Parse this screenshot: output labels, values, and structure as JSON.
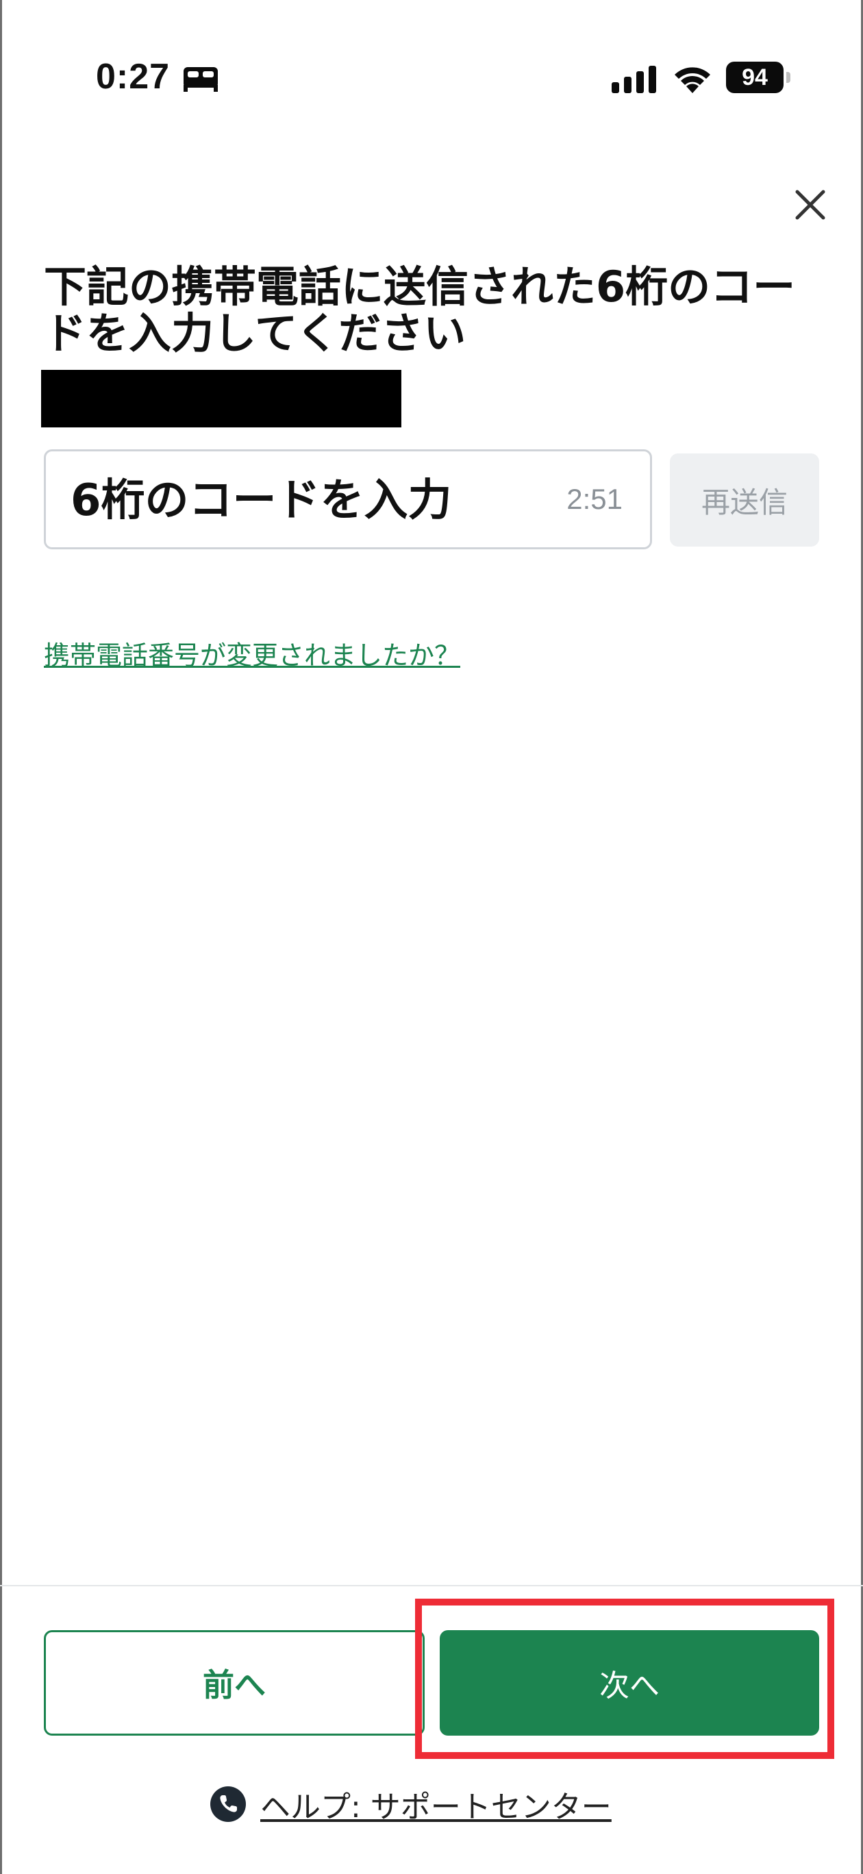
{
  "status_bar": {
    "time": "0:27",
    "battery": "94",
    "icons": [
      "bed-icon",
      "cellular-signal-icon",
      "wifi-icon",
      "battery-icon"
    ]
  },
  "header": {
    "close_icon": "close-icon"
  },
  "main": {
    "heading": "下記の携帯電話に送信された6桁のコードを入力してください",
    "code_input": {
      "placeholder": "6桁のコードを入力",
      "value": ""
    },
    "timer": "2:51",
    "resend_label": "再送信",
    "phone_changed_link": "携帯電話番号が変更されましたか？"
  },
  "footer": {
    "back_label": "前へ",
    "next_label": "次へ",
    "help_label": "ヘルプ: サポートセンター",
    "help_icon": "phone-icon"
  },
  "colors": {
    "accent_green": "#1c8450",
    "highlight_red": "#ee2c36",
    "muted_gray": "#9aa0a6"
  }
}
